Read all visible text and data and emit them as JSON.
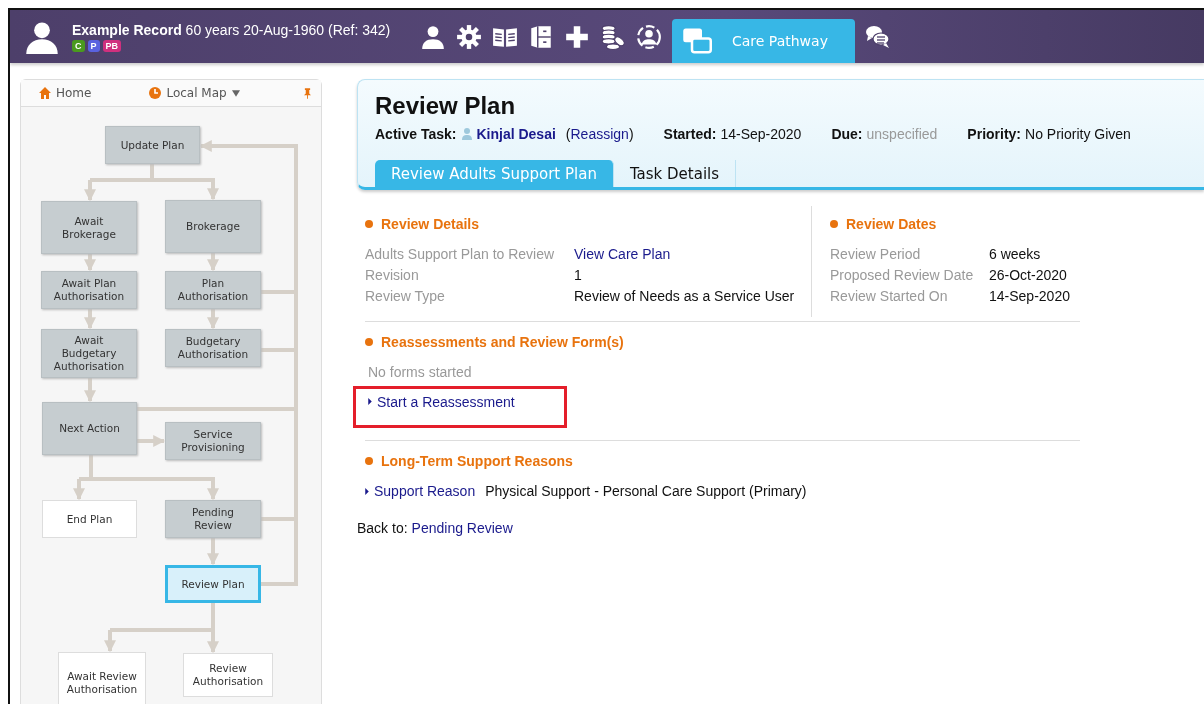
{
  "header": {
    "record": "**Example Record** 60 years 20-Aug-1960 (Ref: 342)",
    "badges": [
      {
        "label": "C",
        "color": "#4a9a1e"
      },
      {
        "label": "P",
        "color": "#5a62e0"
      },
      {
        "label": "PB",
        "color": "#d0307e"
      }
    ],
    "nav_tab": {
      "label": "Care Pathway",
      "selected": true
    }
  },
  "side_panel": {
    "home": "Home",
    "map": "Local Map",
    "nodes": [
      {
        "label": "Update Plan",
        "kind": "done",
        "selected": false
      },
      {
        "label": "Await Brokerage",
        "kind": "done",
        "selected": false
      },
      {
        "label": "Brokerage",
        "kind": "done",
        "selected": false
      },
      {
        "label": "Await Plan Authorisation",
        "kind": "done",
        "selected": false
      },
      {
        "label": "Plan Authorisation",
        "kind": "done",
        "selected": false
      },
      {
        "label": "Await Budgetary Authorisation",
        "kind": "done",
        "selected": false
      },
      {
        "label": "Budgetary Authorisation",
        "kind": "done",
        "selected": false
      },
      {
        "label": "Next Action",
        "kind": "done",
        "selected": false
      },
      {
        "label": "Service Provisioning",
        "kind": "done",
        "selected": false
      },
      {
        "label": "End Plan",
        "kind": "future",
        "selected": false
      },
      {
        "label": "Pending Review",
        "kind": "done",
        "selected": false
      },
      {
        "label": "Review Plan",
        "kind": "done",
        "selected": true
      },
      {
        "label": "Await Review Authorisation",
        "kind": "future",
        "selected": false
      },
      {
        "label": "Review Authorisation",
        "kind": "future",
        "selected": false
      }
    ]
  },
  "task": {
    "title": "Review Plan",
    "active_task_label": "Active Task:",
    "assignee": "Kinjal Desai",
    "open_paren": "(",
    "reassign": "Reassign",
    "close_paren": ")",
    "started_label": "Started:",
    "started": "14-Sep-2020",
    "due_label": "Due:",
    "due": "unspecified",
    "priority_label": "Priority:",
    "priority": "No Priority Given",
    "tabs": [
      {
        "label": "Review Adults Support Plan",
        "selected": true
      },
      {
        "label": "Task Details",
        "selected": false
      }
    ]
  },
  "review_details": {
    "heading": "Review Details",
    "rows": [
      {
        "label": "Adults Support Plan to Review",
        "value": "View Care Plan",
        "kind": "link"
      },
      {
        "label": "Revision",
        "value": "1",
        "kind": "text"
      },
      {
        "label": "Review Type",
        "value": "Review of Needs as a Service User",
        "kind": "text"
      }
    ]
  },
  "review_dates": {
    "heading": "Review Dates",
    "rows": [
      {
        "label": "Review Period",
        "value": "6 weeks"
      },
      {
        "label": "Proposed Review Date",
        "value": "26-Oct-2020"
      },
      {
        "label": "Review Started On",
        "value": "14-Sep-2020"
      }
    ]
  },
  "forms": {
    "heading": "Reassessments and Review Form(s)",
    "empty": "No forms started",
    "link": "Start a Reassessment",
    "highlighted": true
  },
  "reasons": {
    "heading": "Long-Term Support Reasons",
    "link": "Support Reason",
    "value": "Physical Support - Personal Care Support (Primary)"
  },
  "back": {
    "label": "Back to:",
    "link": "Pending Review"
  }
}
